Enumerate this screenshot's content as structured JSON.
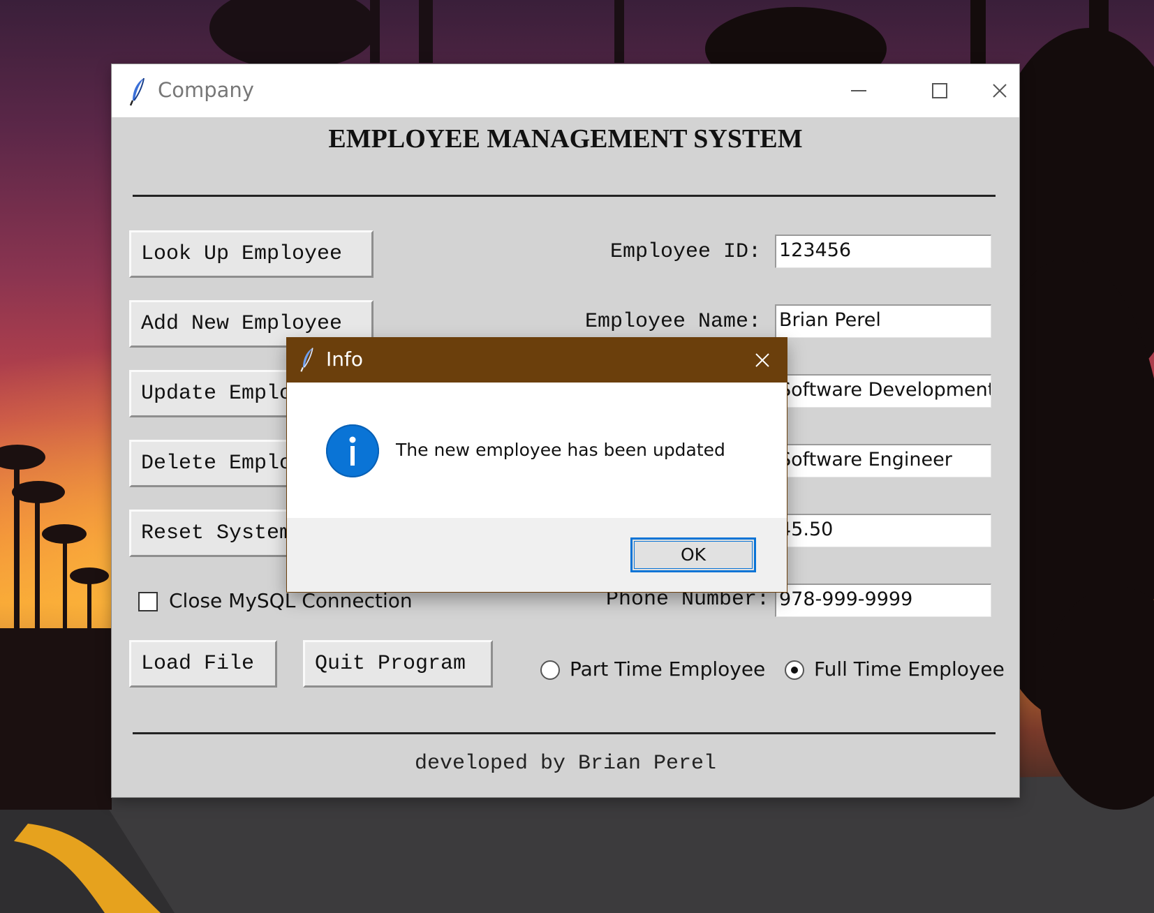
{
  "window": {
    "title": "Company",
    "controls": [
      "minimize",
      "maximize",
      "close"
    ]
  },
  "app": {
    "heading": "EMPLOYEE MANAGEMENT SYSTEM",
    "footer": "developed by Brian Perel"
  },
  "buttons": {
    "look_up": "Look Up Employee",
    "add_new": "Add New Employee",
    "update": "Update Employee",
    "delete": "Delete Employee",
    "reset": "Reset System",
    "load_file": "Load File",
    "quit": "Quit Program"
  },
  "checkbox": {
    "label": "Close MySQL Connection",
    "checked": false
  },
  "fields": {
    "employee_id": {
      "label": "Employee ID:",
      "value": "123456"
    },
    "employee_name": {
      "label": "Employee Name:",
      "value": "Brian Perel"
    },
    "department": {
      "value": "Software Development"
    },
    "title": {
      "value": "Software Engineer"
    },
    "pay": {
      "value": "45.50"
    },
    "phone": {
      "label": "Phone Number:",
      "value": "978-999-9999"
    }
  },
  "employment_type": {
    "options": [
      "Part Time Employee",
      "Full Time Employee"
    ],
    "selected": "Full Time Employee"
  },
  "dialog": {
    "title": "Info",
    "message": "The new employee has been updated",
    "ok_label": "OK",
    "icon": "info-icon",
    "accent_color": "#6b3f0c"
  },
  "colors": {
    "window_bg": "#d3d3d3",
    "info_blue": "#0a74d6"
  }
}
